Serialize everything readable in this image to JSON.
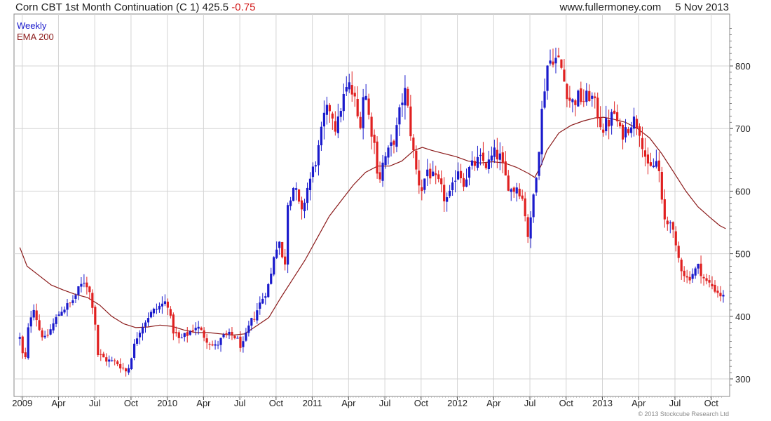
{
  "header": {
    "instrument": "Corn CBT 1st Month Continuation (C 1)",
    "last": "425.5",
    "change": "-0.75",
    "website": "www.fullermoney.com",
    "date": "5 Nov 2013"
  },
  "legend": {
    "period": "Weekly",
    "indicator": "EMA 200"
  },
  "copyright": "© 2013 Stockcube Research Ltd",
  "colors": {
    "up": "#1a1acc",
    "down": "#e02020",
    "ema": "#8b1a1a",
    "grid": "#d4d4d4",
    "axis": "#555555"
  },
  "chart_data": {
    "type": "candlestick",
    "title": "Corn CBT 1st Month Continuation (C 1)",
    "frequency": "weekly",
    "ylim": [
      280,
      870
    ],
    "y_ticks": [
      300,
      400,
      500,
      600,
      700,
      800
    ],
    "x_ticks": [
      {
        "label": "2009",
        "t": 0.1
      },
      {
        "label": "Apr",
        "t": 3.1
      },
      {
        "label": "Jul",
        "t": 6.1
      },
      {
        "label": "Oct",
        "t": 9.1
      },
      {
        "label": "2010",
        "t": 12.1
      },
      {
        "label": "Apr",
        "t": 15.1
      },
      {
        "label": "Jul",
        "t": 18.1
      },
      {
        "label": "Oct",
        "t": 21.1
      },
      {
        "label": "2011",
        "t": 24.1
      },
      {
        "label": "Apr",
        "t": 27.1
      },
      {
        "label": "Jul",
        "t": 30.1
      },
      {
        "label": "Oct",
        "t": 33.1
      },
      {
        "label": "2012",
        "t": 36.1
      },
      {
        "label": "Apr",
        "t": 39.1
      },
      {
        "label": "Jul",
        "t": 42.1
      },
      {
        "label": "Oct",
        "t": 45.1
      },
      {
        "label": "2013",
        "t": 48.1
      },
      {
        "label": "Apr",
        "t": 51.1
      },
      {
        "label": "Jul",
        "t": 54.1
      },
      {
        "label": "Oct",
        "t": 57.1
      }
    ],
    "close_anchors": [
      [
        -0.1,
        365
      ],
      [
        0.3,
        320
      ],
      [
        0.6,
        380
      ],
      [
        1.0,
        420
      ],
      [
        1.5,
        380
      ],
      [
        2.0,
        362
      ],
      [
        2.6,
        385
      ],
      [
        3.3,
        410
      ],
      [
        4.1,
        420
      ],
      [
        5.3,
        460
      ],
      [
        5.8,
        430
      ],
      [
        6.1,
        400
      ],
      [
        6.3,
        340
      ],
      [
        7.1,
        330
      ],
      [
        8.0,
        325
      ],
      [
        8.8,
        310
      ],
      [
        9.1,
        335
      ],
      [
        9.7,
        375
      ],
      [
        10.5,
        400
      ],
      [
        11.2,
        412
      ],
      [
        12.1,
        425
      ],
      [
        12.5,
        380
      ],
      [
        13.1,
        362
      ],
      [
        13.8,
        372
      ],
      [
        14.5,
        385
      ],
      [
        15.3,
        365
      ],
      [
        16.0,
        350
      ],
      [
        16.8,
        368
      ],
      [
        17.6,
        370
      ],
      [
        18.3,
        350
      ],
      [
        18.9,
        385
      ],
      [
        19.4,
        405
      ],
      [
        20.0,
        430
      ],
      [
        20.6,
        455
      ],
      [
        21.0,
        510
      ],
      [
        21.4,
        520
      ],
      [
        21.8,
        465
      ],
      [
        22.0,
        580
      ],
      [
        22.6,
        610
      ],
      [
        23.2,
        560
      ],
      [
        23.6,
        600
      ],
      [
        24.1,
        630
      ],
      [
        24.6,
        665
      ],
      [
        25.1,
        720
      ],
      [
        25.6,
        735
      ],
      [
        26.1,
        695
      ],
      [
        26.5,
        740
      ],
      [
        27.1,
        770
      ],
      [
        27.6,
        745
      ],
      [
        28.0,
        700
      ],
      [
        28.4,
        770
      ],
      [
        28.8,
        715
      ],
      [
        29.2,
        680
      ],
      [
        29.6,
        615
      ],
      [
        30.0,
        650
      ],
      [
        30.5,
        665
      ],
      [
        31.0,
        690
      ],
      [
        31.5,
        745
      ],
      [
        31.8,
        760
      ],
      [
        32.2,
        700
      ],
      [
        32.6,
        640
      ],
      [
        33.1,
        600
      ],
      [
        33.6,
        635
      ],
      [
        34.1,
        620
      ],
      [
        34.6,
        610
      ],
      [
        35.1,
        585
      ],
      [
        35.6,
        595
      ],
      [
        36.1,
        640
      ],
      [
        36.6,
        615
      ],
      [
        37.1,
        635
      ],
      [
        37.6,
        645
      ],
      [
        38.1,
        650
      ],
      [
        38.6,
        640
      ],
      [
        39.1,
        660
      ],
      [
        39.6,
        655
      ],
      [
        40.1,
        620
      ],
      [
        40.6,
        600
      ],
      [
        41.1,
        610
      ],
      [
        41.6,
        580
      ],
      [
        42.0,
        520
      ],
      [
        42.4,
        595
      ],
      [
        42.8,
        660
      ],
      [
        43.1,
        730
      ],
      [
        43.5,
        800
      ],
      [
        44.0,
        815
      ],
      [
        44.6,
        805
      ],
      [
        45.0,
        770
      ],
      [
        45.5,
        740
      ],
      [
        46.1,
        750
      ],
      [
        46.6,
        745
      ],
      [
        47.1,
        755
      ],
      [
        47.6,
        730
      ],
      [
        48.1,
        700
      ],
      [
        48.6,
        710
      ],
      [
        49.1,
        725
      ],
      [
        49.6,
        690
      ],
      [
        50.1,
        700
      ],
      [
        50.6,
        715
      ],
      [
        51.1,
        705
      ],
      [
        51.5,
        670
      ],
      [
        51.9,
        630
      ],
      [
        52.3,
        640
      ],
      [
        52.7,
        650
      ],
      [
        53.1,
        560
      ],
      [
        53.4,
        545
      ],
      [
        53.7,
        560
      ],
      [
        54.1,
        510
      ],
      [
        54.6,
        480
      ],
      [
        55.1,
        460
      ],
      [
        55.6,
        470
      ],
      [
        56.1,
        480
      ],
      [
        56.6,
        455
      ],
      [
        57.1,
        450
      ],
      [
        57.6,
        440
      ],
      [
        58.0,
        432
      ],
      [
        58.3,
        426
      ]
    ],
    "ema_200": [
      [
        -0.1,
        510
      ],
      [
        0.5,
        480
      ],
      [
        1.5,
        465
      ],
      [
        2.5,
        450
      ],
      [
        3.5,
        442
      ],
      [
        4.5,
        435
      ],
      [
        5.5,
        430
      ],
      [
        6.5,
        418
      ],
      [
        7.5,
        400
      ],
      [
        8.5,
        388
      ],
      [
        9.5,
        382
      ],
      [
        10.5,
        383
      ],
      [
        11.5,
        386
      ],
      [
        12.5,
        384
      ],
      [
        13.5,
        378
      ],
      [
        14.5,
        374
      ],
      [
        15.5,
        374
      ],
      [
        16.5,
        372
      ],
      [
        17.5,
        370
      ],
      [
        18.5,
        372
      ],
      [
        19.5,
        385
      ],
      [
        20.5,
        398
      ],
      [
        21.5,
        430
      ],
      [
        22.5,
        460
      ],
      [
        23.5,
        490
      ],
      [
        24.5,
        525
      ],
      [
        25.5,
        560
      ],
      [
        26.5,
        585
      ],
      [
        27.5,
        610
      ],
      [
        28.5,
        630
      ],
      [
        29.5,
        640
      ],
      [
        30.5,
        640
      ],
      [
        31.5,
        648
      ],
      [
        32.5,
        665
      ],
      [
        33.2,
        670
      ],
      [
        34.0,
        665
      ],
      [
        35.0,
        660
      ],
      [
        36.0,
        655
      ],
      [
        37.0,
        648
      ],
      [
        38.0,
        645
      ],
      [
        39.0,
        647
      ],
      [
        40.0,
        645
      ],
      [
        41.0,
        638
      ],
      [
        42.0,
        628
      ],
      [
        42.5,
        622
      ],
      [
        43.0,
        640
      ],
      [
        43.5,
        665
      ],
      [
        44.5,
        693
      ],
      [
        45.5,
        705
      ],
      [
        46.5,
        712
      ],
      [
        47.5,
        717
      ],
      [
        48.2,
        718
      ],
      [
        49.0,
        715
      ],
      [
        50.0,
        710
      ],
      [
        51.0,
        700
      ],
      [
        52.0,
        685
      ],
      [
        53.0,
        660
      ],
      [
        54.0,
        630
      ],
      [
        55.0,
        600
      ],
      [
        56.0,
        575
      ],
      [
        57.0,
        558
      ],
      [
        57.8,
        545
      ],
      [
        58.3,
        540
      ]
    ],
    "t_range": [
      -0.1,
      58.3
    ],
    "last_close": 425.5
  }
}
